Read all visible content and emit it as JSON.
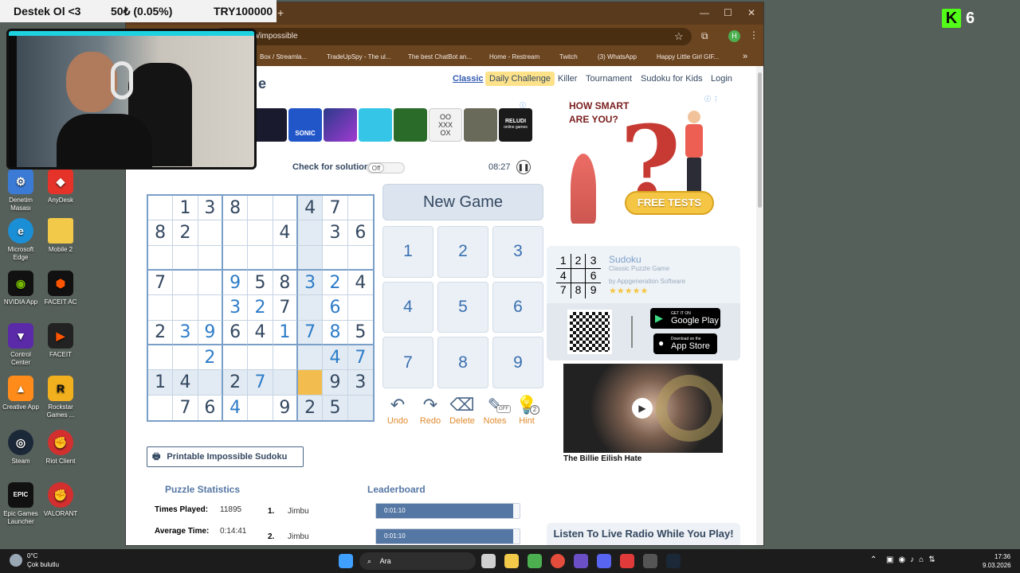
{
  "stream_header": {
    "left": "Destek Ol <3",
    "middle": "50₺ (0.05%)",
    "right": "TRY100000"
  },
  "channel_badge": "6",
  "desktop_icons": [
    {
      "label": "Denetim Masası"
    },
    {
      "label": "AnyDesk"
    },
    {
      "label": "Microsoft Edge"
    },
    {
      "label": "Mobile 2"
    },
    {
      "label": "NVIDIA App"
    },
    {
      "label": "FACEIT AC"
    },
    {
      "label": "Control Center"
    },
    {
      "label": "FACEIT"
    },
    {
      "label": "Creative App"
    },
    {
      "label": "Rockstar Games ..."
    },
    {
      "label": "Steam"
    },
    {
      "label": "Riot Client"
    },
    {
      "label": "Epic Games Launcher"
    },
    {
      "label": "VALORANT"
    }
  ],
  "browser": {
    "url": "p/impossible",
    "bookmarks": [
      "Box / Streamla...",
      "TradeUpSpy - The ul...",
      "The best ChatBot an...",
      "Home - Restream",
      "Twitch",
      "(3) WhatsApp",
      "Happy Little Girl GIF..."
    ],
    "profile_initial": "H"
  },
  "site": {
    "logo_tail": "e",
    "nav": {
      "classic": "Classic",
      "daily": "Daily Challenge",
      "killer": "Killer",
      "tournament": "Tournament",
      "kids": "Sudoku for Kids",
      "login": "Login"
    },
    "check_label": "Check for solution:",
    "check_toggle": "Off",
    "timer": "08:27",
    "new_game": "New Game",
    "numpad": [
      "1",
      "2",
      "3",
      "4",
      "5",
      "6",
      "7",
      "8",
      "9"
    ],
    "tools": {
      "undo": "Undo",
      "redo": "Redo",
      "delete": "Delete",
      "notes": "Notes",
      "notes_badge": "OFF",
      "hint": "Hint",
      "hint_badge": "2"
    },
    "printable": "Printable Impossible Sudoku",
    "stats": {
      "title": "Puzzle Statistics",
      "times_played_label": "Times Played:",
      "times_played": "11895",
      "avg_time_label": "Average Time:",
      "avg_time": "0:14:41"
    },
    "leaderboard": {
      "title": "Leaderboard",
      "entries": [
        {
          "rank": "1.",
          "name": "Jimbu",
          "time": "0:01:10"
        },
        {
          "rank": "2.",
          "name": "Jimbu",
          "time": "0:01:10"
        }
      ]
    },
    "ad": {
      "question": "HOW SMART ARE YOU?",
      "button": "FREE TESTS"
    },
    "app_promo": {
      "title": "Sudoku",
      "subtitle": "Classic Puzzle Game",
      "by": "by Appgeneration Software",
      "google_top": "GET IT ON",
      "google": "Google Play",
      "apple_top": "Download on the",
      "apple": "App Store",
      "mini_grid": [
        "1",
        "2",
        "3",
        "4",
        "",
        "6",
        "7",
        "8",
        "9"
      ]
    },
    "video_caption": "The Billie Eilish Hate",
    "radio": "Listen To Live Radio While You Play!",
    "game_icon_texts": {
      "sonic": "SONIC",
      "reludi": "RELUDI",
      "reludi_sub": "online games",
      "ttt": "OO XXX OX"
    }
  },
  "grid": [
    [
      "",
      "1",
      "3",
      "8",
      "",
      "",
      "4",
      "7",
      ""
    ],
    [
      "8",
      "2",
      "",
      "",
      "",
      "4",
      "",
      "3",
      "6"
    ],
    [
      "",
      "",
      "",
      "",
      "",
      "",
      "",
      "",
      ""
    ],
    [
      "7",
      "",
      "",
      "9",
      "5",
      "8",
      "3",
      "2",
      "4"
    ],
    [
      "",
      "",
      "",
      "3",
      "2",
      "7",
      "",
      "6",
      ""
    ],
    [
      "2",
      "3",
      "9",
      "6",
      "4",
      "1",
      "7",
      "8",
      "5"
    ],
    [
      "",
      "",
      "2",
      "",
      "",
      "",
      "",
      "4",
      "7"
    ],
    [
      "1",
      "4",
      "",
      "2",
      "7",
      "",
      "",
      "9",
      "3"
    ],
    [
      "",
      "7",
      "6",
      "4",
      "",
      "9",
      "2",
      "5",
      ""
    ]
  ],
  "user_cells": [
    "3-3",
    "3-6",
    "3-7",
    "4-3",
    "4-4",
    "4-7",
    "5-1",
    "5-2",
    "5-5",
    "5-6",
    "5-7",
    "6-2",
    "6-7",
    "6-8",
    "7-4",
    "8-3"
  ],
  "selected_cell": "7-6",
  "taskbar": {
    "weather_temp": "0°C",
    "weather_desc": "Çok bulutlu",
    "search": "Ara",
    "time": "17:36",
    "date": "9.03.2026"
  },
  "colors": {
    "grid_border": "#7a9fc8",
    "given_digit": "#344861",
    "user_digit": "#2d7cc8",
    "selected_cell": "#f2bd4e",
    "tool_label": "#e08a2e",
    "browser_frame": "#6b4420"
  }
}
